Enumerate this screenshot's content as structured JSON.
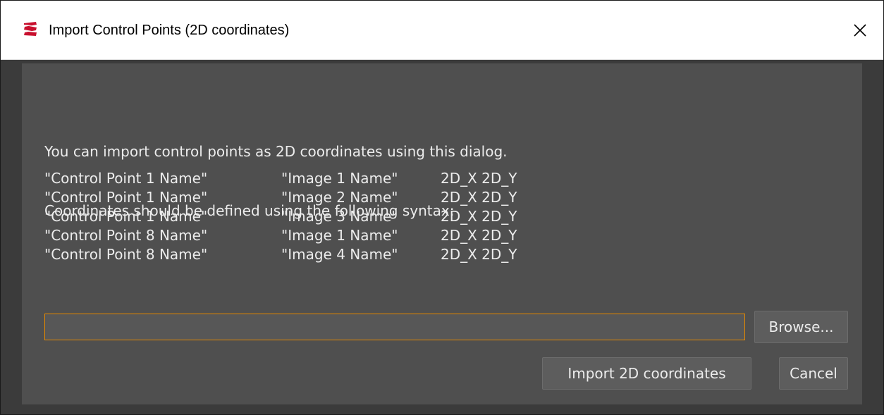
{
  "window": {
    "title": "Import Control Points (2D coordinates)",
    "icon": "app-logo-icon",
    "accent": "#e68a00"
  },
  "intro": {
    "line1": "You can import control points as 2D coordinates using this dialog.",
    "line2": "Coordinates should be defined using the following syntax:"
  },
  "syntax_rows": [
    {
      "control_point": "\"Control Point 1 Name\"",
      "image": "\"Image 1 Name\"",
      "coords": "2D_X 2D_Y"
    },
    {
      "control_point": "\"Control Point 1 Name\"",
      "image": "\"Image 2 Name\"",
      "coords": "2D_X 2D_Y"
    },
    {
      "control_point": "\"Control Point 1 Name\"",
      "image": "\"Image 3 Name\"",
      "coords": "2D_X 2D_Y"
    },
    {
      "control_point": "\"Control Point 8 Name\"",
      "image": "\"Image 1 Name\"",
      "coords": "2D_X 2D_Y"
    },
    {
      "control_point": "\"Control Point 8 Name\"",
      "image": "\"Image 4 Name\"",
      "coords": "2D_X 2D_Y"
    }
  ],
  "file_input": {
    "value": "",
    "placeholder": ""
  },
  "buttons": {
    "browse": "Browse...",
    "import": "Import 2D coordinates",
    "cancel": "Cancel"
  }
}
